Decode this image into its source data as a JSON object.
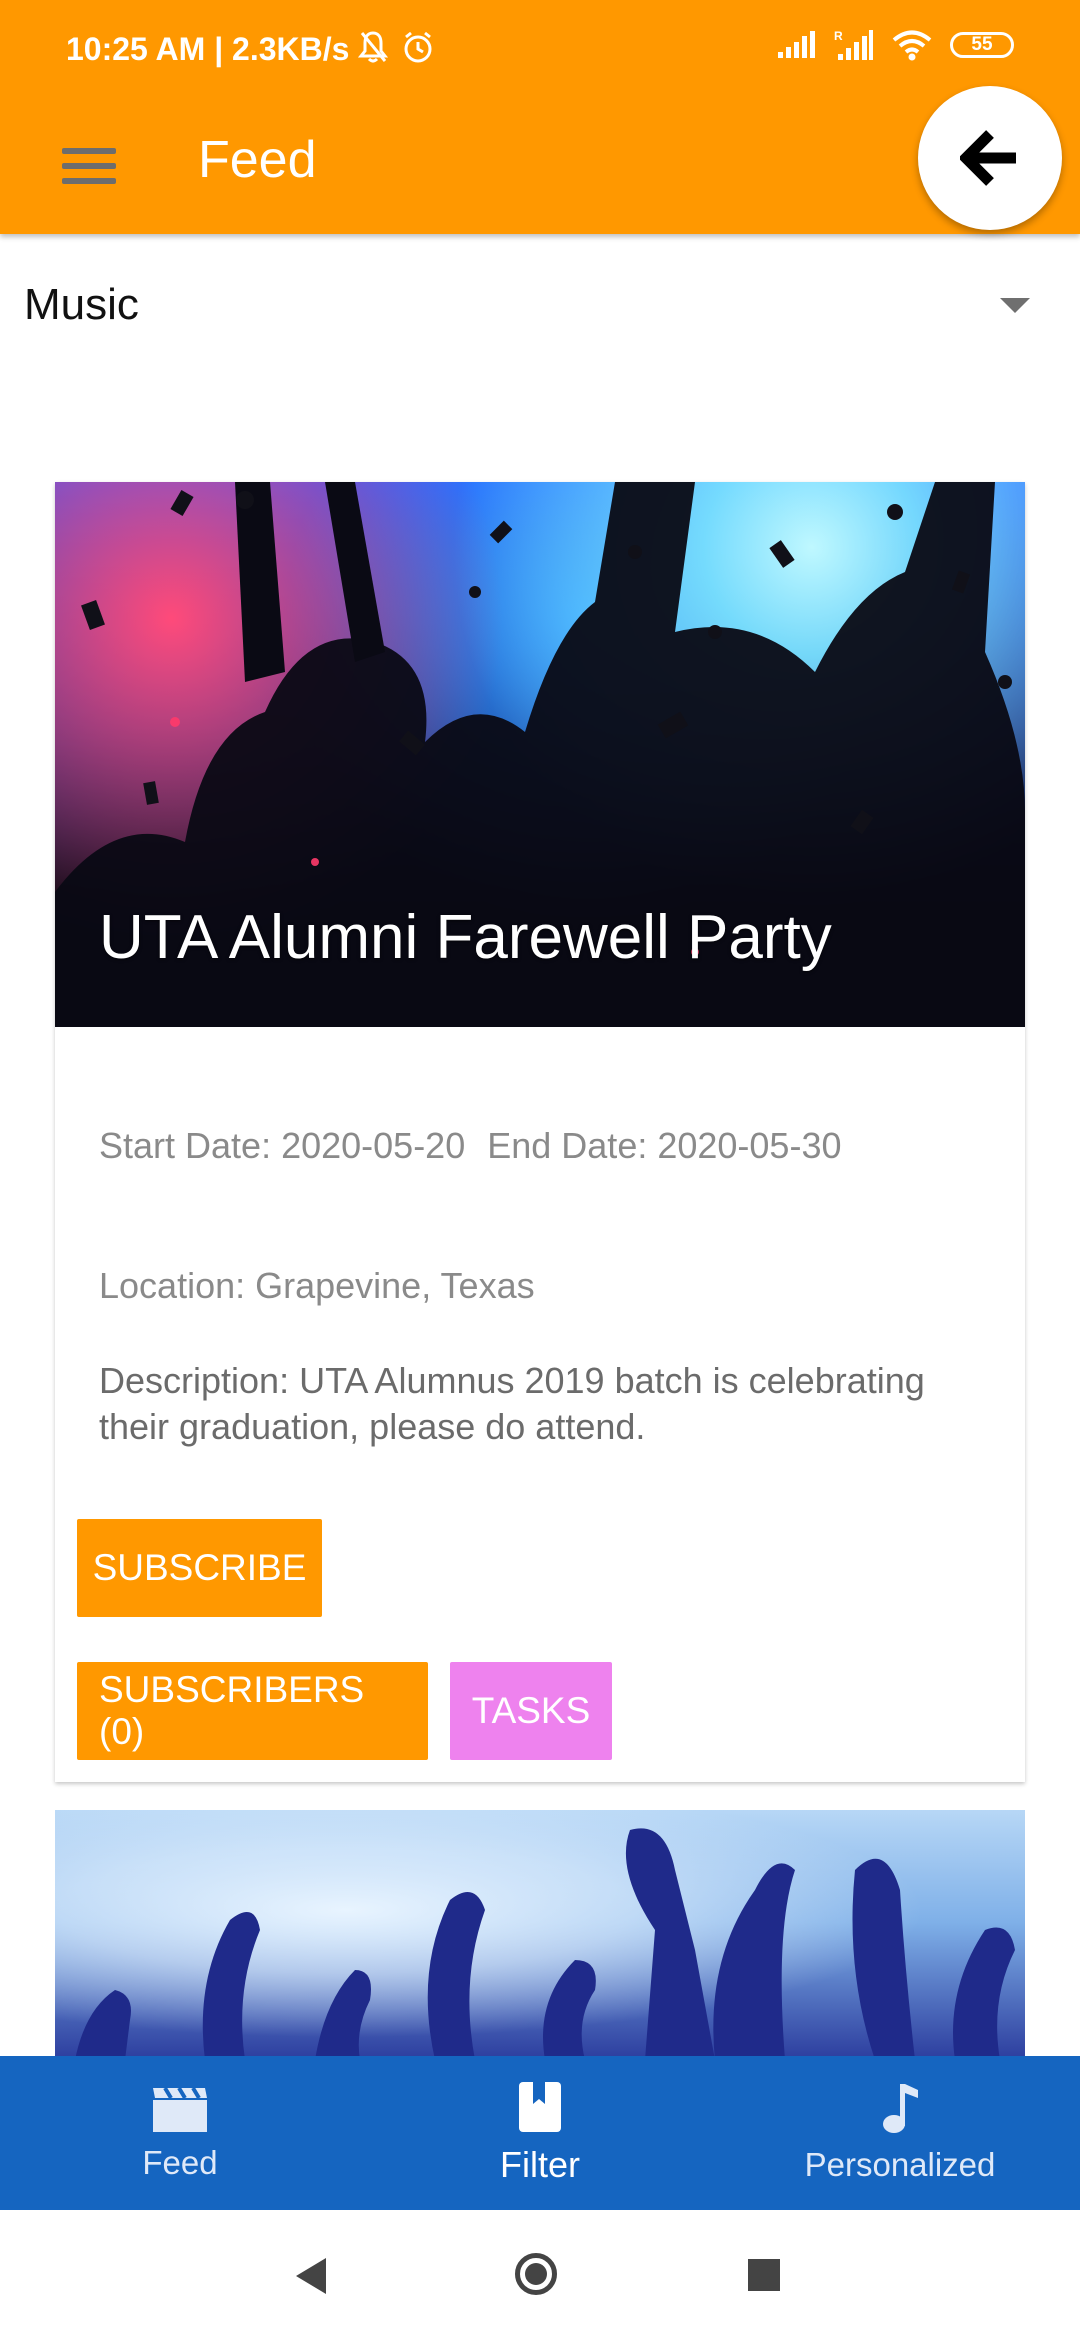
{
  "status_bar": {
    "time": "10:25 AM | 2.3KB/s",
    "battery": "55"
  },
  "app_bar": {
    "title": "Feed",
    "menu_icon": "hamburger-menu-icon",
    "back_icon": "arrow-back-icon"
  },
  "category_dropdown": {
    "selected": "Music"
  },
  "event": {
    "title": "UTA Alumni Farewell Party",
    "start_date": "Start Date: 2020-05-20",
    "end_date": "End Date: 2020-05-30",
    "location": "Location: Grapevine, Texas",
    "description": "Description: UTA Alumnus 2019 batch is celebrating their graduation, please do attend.",
    "subscribe_label": "SUBSCRIBE",
    "subscribers_label": "SUBSCRIBERS (0)",
    "tasks_label": "TASKS"
  },
  "bottom_nav": {
    "items": [
      {
        "label": "Feed",
        "icon": "movie-clapper-icon"
      },
      {
        "label": "Filter",
        "icon": "bookmark-book-icon"
      },
      {
        "label": "Personalized",
        "icon": "music-note-icon"
      }
    ],
    "active_index": 1
  },
  "colors": {
    "app_bar": "#ff9800",
    "primary_button": "#ff9800",
    "tasks_button": "#ee82ee",
    "bottom_nav": "#1565c0"
  }
}
